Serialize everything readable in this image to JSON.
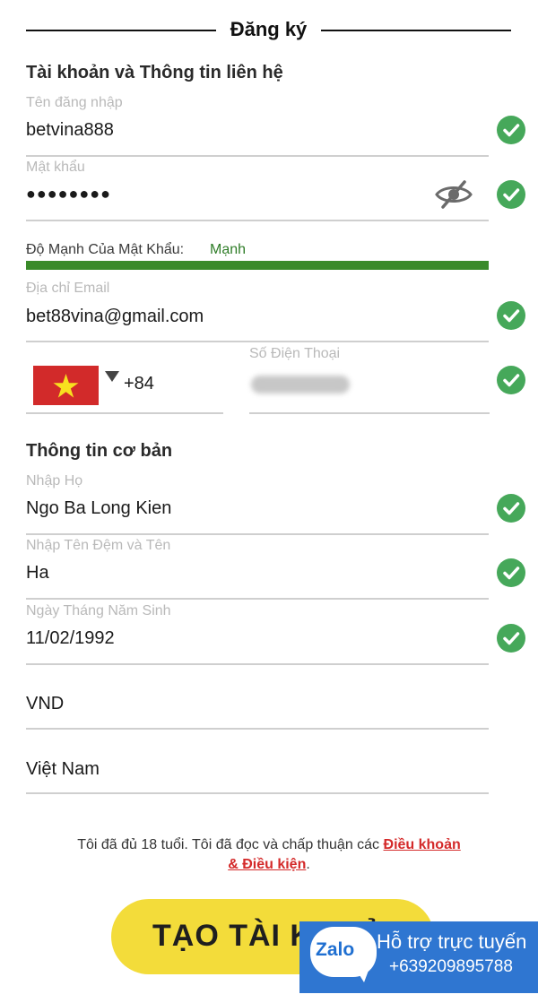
{
  "header": {
    "title": "Đăng ký"
  },
  "sections": {
    "account_title": "Tài khoản và Thông tin liên hệ",
    "basic_title": "Thông tin cơ bản"
  },
  "fields": {
    "username": {
      "label": "Tên đăng nhập",
      "value": "betvina888"
    },
    "password": {
      "label": "Mật khẩu",
      "value": "●●●●●●●●"
    },
    "email": {
      "label": "Địa chỉ Email",
      "value": "bet88vina@gmail.com"
    },
    "phone": {
      "label": "Số Điện Thoại",
      "dial_code": "+84"
    },
    "last_name": {
      "label": "Nhập Họ",
      "value": "Ngo Ba Long Kien"
    },
    "first_name": {
      "label": "Nhập Tên Đệm và Tên",
      "value": "Ha"
    },
    "dob": {
      "label": "Ngày Tháng Năm Sinh",
      "value": "11/02/1992"
    },
    "currency": {
      "value": "VND"
    },
    "country": {
      "value": "Việt Nam"
    }
  },
  "password_strength": {
    "label": "Độ Mạnh Của Mật Khẩu:",
    "value": "Mạnh",
    "level": 1.0
  },
  "terms": {
    "text": "Tôi đã đủ 18 tuổi. Tôi đã đọc và chấp thuận các",
    "link_part1": "Điều khoản",
    "link_part2": "& Điều kiện",
    "suffix": "."
  },
  "buttons": {
    "create_account": "TẠO TÀI KHOẢN"
  },
  "zalo": {
    "logo": "Zalo",
    "title": "Hỗ trợ trực tuyến",
    "phone": "+639209895788"
  },
  "colors": {
    "check_green": "#46a85a",
    "strength_green": "#3a8a2a",
    "link_red": "#d42a2a",
    "button_yellow": "#f3dc3a",
    "zalo_blue": "#2f76d1"
  },
  "icons": {
    "valid": "check-circle-icon",
    "toggle_password": "eye-slash-icon",
    "country_flag": "vietnam-flag-icon",
    "dropdown": "caret-down-icon"
  }
}
